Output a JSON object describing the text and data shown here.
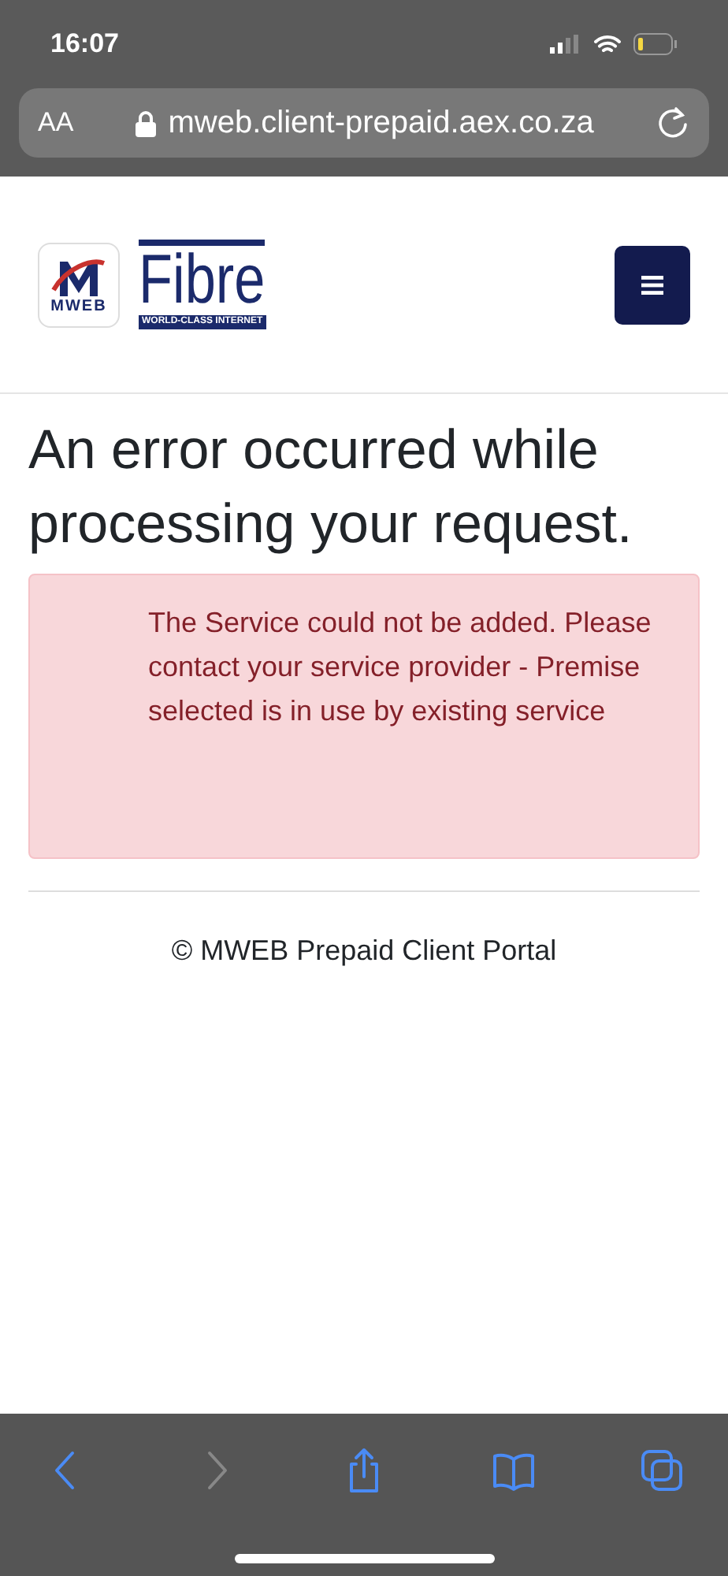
{
  "status_bar": {
    "time": "16:07"
  },
  "address_bar": {
    "text_size_button": "AA",
    "url": "mweb.client-prepaid.aex.co.za"
  },
  "header": {
    "logo_badge": "MWEB",
    "logo_title": "Fibre",
    "logo_tagline": "WORLD-CLASS INTERNET"
  },
  "heading": "An error occurred while processing your request.",
  "alert": {
    "message": "The Service could not be added. Please contact your service provider - Premise selected is in use by existing service"
  },
  "footer": "© MWEB Prepaid Client Portal",
  "toolbar": [
    {
      "kind": "back",
      "disabled": false
    },
    {
      "kind": "forward",
      "disabled": true
    },
    {
      "kind": "share",
      "disabled": false
    },
    {
      "kind": "bookmarks",
      "disabled": false
    },
    {
      "kind": "tabs",
      "disabled": false
    }
  ]
}
